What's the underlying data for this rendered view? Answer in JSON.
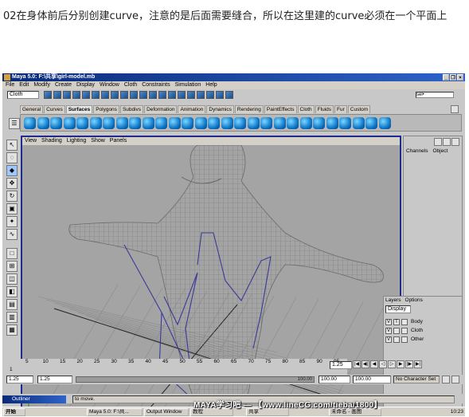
{
  "caption": "02在身体前后分别创建curve，注意的是后面需要缝合，所以在这里建的curve必须在一个平面上",
  "window": {
    "title": "Maya 5.0: F:\\共享\\girl-model.mb",
    "controls": [
      "_",
      "❐",
      "×"
    ]
  },
  "menu": [
    "File",
    "Edit",
    "Modify",
    "Create",
    "Display",
    "Window",
    "Cloth",
    "Constraints",
    "Simulation",
    "Help"
  ],
  "mode_selector": "Cloth",
  "selection_field": "sel•",
  "shelf_tabs": [
    "General",
    "Curves",
    "Surfaces",
    "Polygons",
    "Subdivs",
    "Deformation",
    "Animation",
    "Dynamics",
    "Rendering",
    "PaintEffects",
    "Cloth",
    "Fluids",
    "Fur",
    "Custom"
  ],
  "active_shelf_tab": "Surfaces",
  "panel_menu": [
    "View",
    "Shading",
    "Lighting",
    "Show",
    "Panels"
  ],
  "axis_label": "persp",
  "channel_box_tabs": [
    "Channels",
    "Object"
  ],
  "layers": {
    "menu": [
      "Layers",
      "Options"
    ],
    "dropdown": "Display",
    "rows": [
      {
        "v": "V",
        "t": "T",
        "name": "Body"
      },
      {
        "v": "V",
        "t": "",
        "name": "Cloth"
      },
      {
        "v": "V",
        "t": "",
        "name": "Other"
      }
    ]
  },
  "timeline": {
    "ticks": [
      "5",
      "10",
      "15",
      "20",
      "25",
      "30",
      "35",
      "40",
      "45",
      "50",
      "55",
      "60",
      "65",
      "70",
      "75",
      "80",
      "85",
      "90",
      "95"
    ],
    "start_marker": "1",
    "current_frame": "1.25"
  },
  "range": {
    "start": "1.25",
    "start_inner": "1.25",
    "slider_label": "100.00",
    "end_inner": "100.00",
    "end": "100.00",
    "character_set": "No Character Set"
  },
  "command": {
    "outliner": "Outliner",
    "help_text": "to move."
  },
  "taskbar": {
    "start": "开始",
    "items": [
      "Maya 5.0: F:\\共...",
      "Output Window",
      "教程",
      "共享",
      "未命名 - 画图"
    ],
    "clock": "10:23"
  },
  "watermark": "MAYA学习吧 — 【www.lineCG.com/tieba/1800】"
}
